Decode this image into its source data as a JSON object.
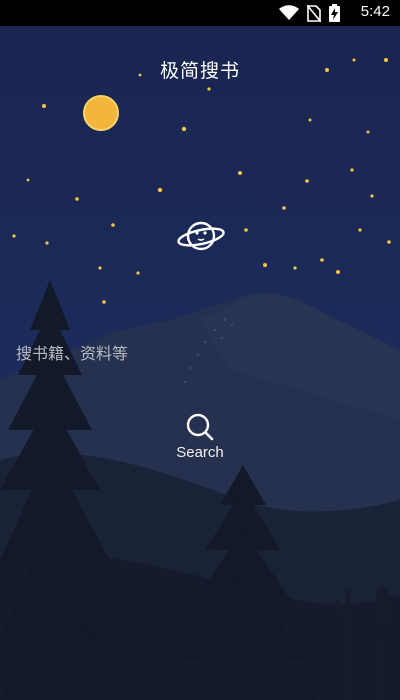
{
  "status_bar": {
    "time": "5:42",
    "icons": [
      "wifi-icon",
      "no-sim-icon",
      "battery-charging-icon"
    ]
  },
  "app": {
    "title": "极简搜书"
  },
  "search": {
    "placeholder": "搜书籍、资料等",
    "value": "",
    "button_label": "Search",
    "button_icon": "search-icon"
  },
  "decor": {
    "center_icon": "planet-icon",
    "background": "night-sky-mountains-illustration"
  },
  "colors": {
    "sky": "#1c2a55",
    "mountain": "#26314f",
    "foreground": "#141c2c",
    "star": "#f3c445",
    "moon": "#f2b63c"
  }
}
